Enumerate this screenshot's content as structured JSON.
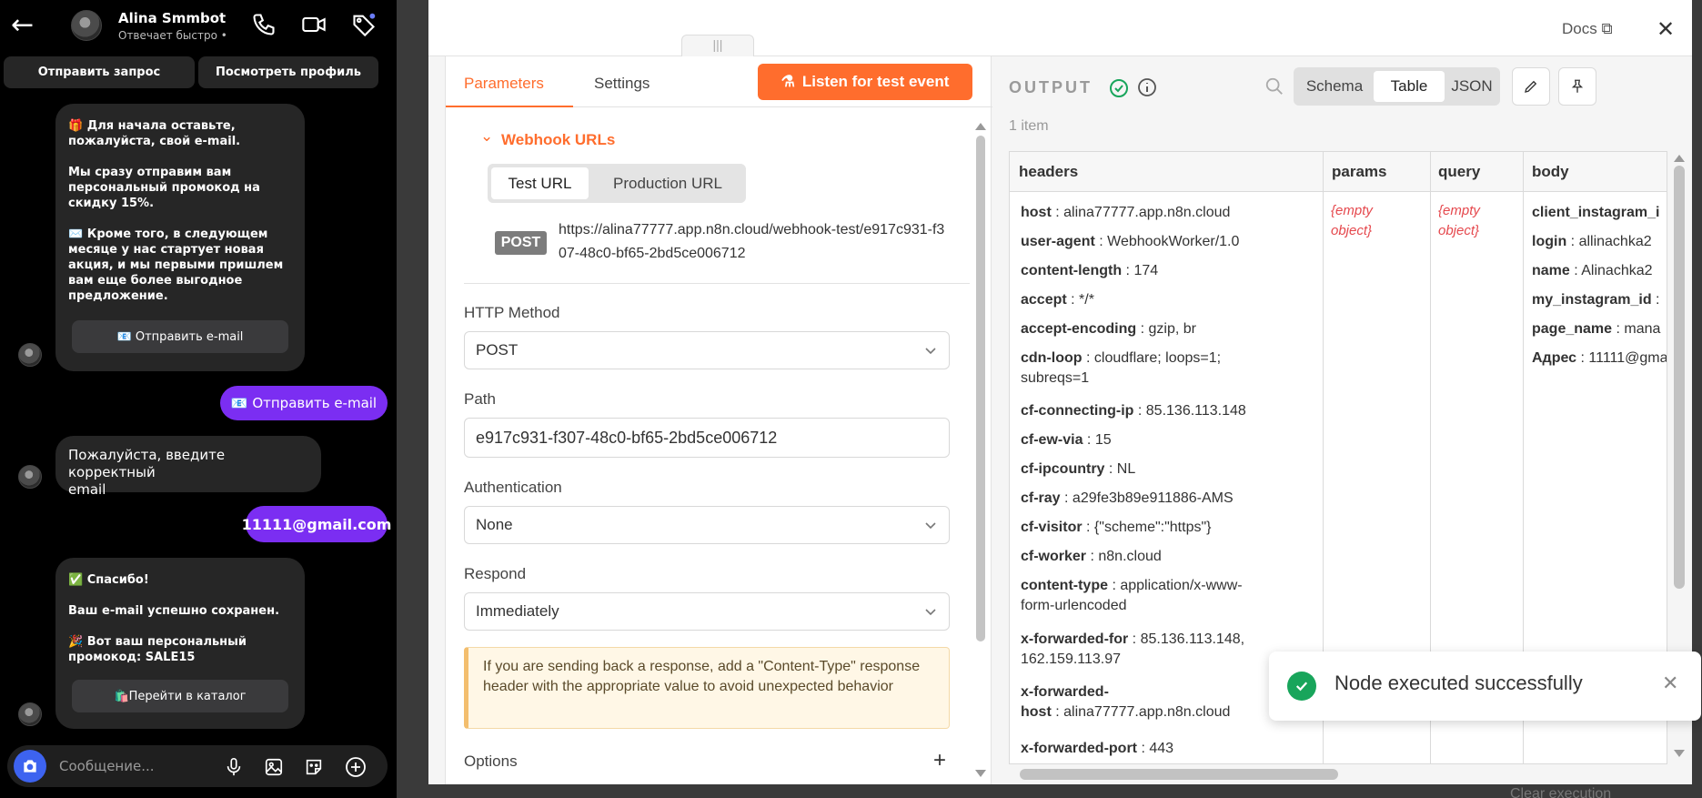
{
  "chat": {
    "contact_name": "Alina Smmbot",
    "contact_status": "Отвечает быстро •",
    "send_request_label": "Отправить запрос",
    "view_profile_label": "Посмотреть профиль",
    "msg1_text": "🎁 Для начала оставьте,\nпожалуйста, свой e-mail.\n\nМы сразу отправим вам\nперсональный промокод на\nскидку 15%.\n\n✉️ Кроме того, в следующем\nмесяце у нас стартует новая\nакция, и мы первыми пришлем\nвам еще более выгодное\nпредложение.",
    "msg1_button": "📧 Отправить e-mail",
    "out1": "📧 Отправить e-mail",
    "msg2_text": "Пожалуйста, введите корректный\nemail",
    "out2": "11111@gmail.com",
    "msg3_text": "✅ Спасибо!\n\nВаш e-mail успешно сохранен.\n\n🎉 Вот ваш персональный\nпромокод: SALE15",
    "msg3_button": "🛍️Перейти в каталог",
    "composer_placeholder": "Сообщение..."
  },
  "n8n": {
    "docs_label": "Docs",
    "tabs": {
      "parameters": "Parameters",
      "settings": "Settings"
    },
    "listen_label": "Listen for test event",
    "webhook_section": "Webhook URLs",
    "url_tabs": {
      "test": "Test URL",
      "production": "Production URL"
    },
    "method_badge": "POST",
    "webhook_url": "https://alina77777.app.n8n.cloud/webhook-test/e917c931-f307-48c0-bf65-2bd5ce006712",
    "http_method_label": "HTTP Method",
    "http_method_value": "POST",
    "path_label": "Path",
    "path_value": "e917c931-f307-48c0-bf65-2bd5ce006712",
    "auth_label": "Authentication",
    "auth_value": "None",
    "respond_label": "Respond",
    "respond_value": "Immediately",
    "notice": "If you are sending back a response, add a \"Content-Type\" response header with the appropriate value to avoid unexpected behavior",
    "options_label": "Options"
  },
  "output": {
    "title": "OUTPUT",
    "views": [
      "Schema",
      "Table",
      "JSON"
    ],
    "active_view": "Table",
    "item_count": "1 item",
    "columns": [
      "headers",
      "params",
      "query",
      "body"
    ],
    "headers": [
      {
        "k": "host",
        "v": "alina77777.app.n8n.cloud"
      },
      {
        "k": "user-agent",
        "v": "WebhookWorker/1.0"
      },
      {
        "k": "content-length",
        "v": "174"
      },
      {
        "k": "accept",
        "v": "*/*"
      },
      {
        "k": "accept-encoding",
        "v": "gzip, br"
      },
      {
        "k": "cdn-loop",
        "v": "cloudflare; loops=1;\n   subreqs=1"
      },
      {
        "k": "cf-connecting-ip",
        "v": "85.136.113.148"
      },
      {
        "k": "cf-ew-via",
        "v": "15"
      },
      {
        "k": "cf-ipcountry",
        "v": "NL"
      },
      {
        "k": "cf-ray",
        "v": "a29fe3b89e911886-AMS"
      },
      {
        "k": "cf-visitor",
        "v": "{\"scheme\":\"https\"}"
      },
      {
        "k": "cf-worker",
        "v": "n8n.cloud"
      },
      {
        "k": "content-type",
        "v": "application/x-www-\n   form-urlencoded"
      },
      {
        "k": "x-forwarded-for",
        "v": "85.136.113.148,\n162.159.113.97"
      },
      {
        "k": "x-forwarded-\n   host",
        "v": "alina77777.app.n8n.cloud"
      },
      {
        "k": "x-forwarded-port",
        "v": "443"
      }
    ],
    "params_empty": "{empty\nobject}",
    "query_empty": "{empty\nobject}",
    "body": [
      {
        "k": "client_instagram_i",
        "v": ""
      },
      {
        "k": "login",
        "v": "allinachka2"
      },
      {
        "k": "name",
        "v": "Alinachka2"
      },
      {
        "k": "my_instagram_id",
        "v": ""
      },
      {
        "k": "page_name",
        "v": "mana"
      },
      {
        "k": "Адрес",
        "v": "11111@gma"
      }
    ]
  },
  "toast": {
    "text": "Node executed successfully"
  },
  "footer": {
    "clear_execution": "Clear execution"
  }
}
